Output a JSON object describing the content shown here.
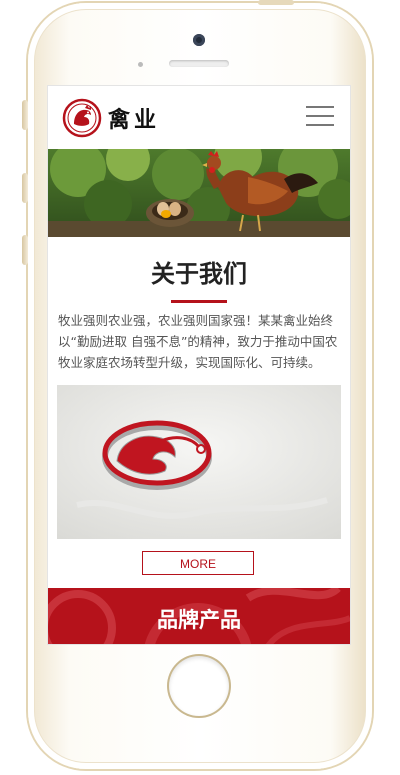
{
  "site": {
    "logo_text": "禽业",
    "logo_mark": "rooster-seal-icon",
    "menu_icon": "hamburger-menu-icon"
  },
  "banner": {
    "alt": "rooster-and-eggs-banner"
  },
  "about": {
    "title": "关于我们",
    "text": "牧业强则农业强，农业强则国家强！某某禽业始终以“勤励进取 自强不息”的精神，致力于推动中国农牧业家庭农场转型升级，实现国际化、可持续。",
    "more_label": "MORE"
  },
  "products": {
    "title": "品牌产品"
  },
  "colors": {
    "accent": "#b5121b",
    "text": "#555555",
    "title": "#222222"
  }
}
